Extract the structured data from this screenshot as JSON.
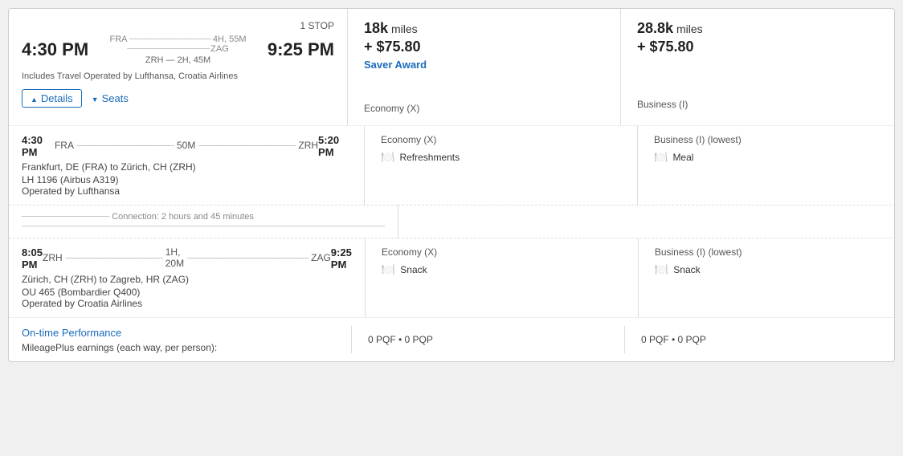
{
  "card": {
    "stop_label": "1 STOP",
    "depart_time": "4:30 PM",
    "arrive_time": "9:25 PM",
    "origin": "FRA",
    "destination": "ZAG",
    "total_duration": "4H, 55M",
    "layover_airport": "ZRH",
    "layover_duration": "2H, 45M",
    "operated_by": "Includes Travel Operated by Lufthansa, Croatia Airlines",
    "details_label": "Details",
    "seats_label": "Seats"
  },
  "economy": {
    "miles": "18k",
    "miles_label": "miles",
    "cash": "+ $75.80",
    "award_label": "Saver Award",
    "cabin": "Economy (X)"
  },
  "business": {
    "miles": "28.8k",
    "miles_label": "miles",
    "cash": "+ $75.80",
    "cabin": "Business (I)"
  },
  "segment1": {
    "depart_time": "4:30 PM",
    "arrive_time": "5:20 PM",
    "origin": "FRA",
    "destination": "ZRH",
    "duration": "50M",
    "route_label": "Frankfurt, DE (FRA) to Zürich, CH (ZRH)",
    "flight_number": "LH 1196 (Airbus A319)",
    "operated_by": "Operated by Lufthansa",
    "economy_cabin": "Economy (X)",
    "business_cabin": "Business (I) (lowest)",
    "economy_meal": "Refreshments",
    "business_meal": "Meal",
    "meal_icon": "🍽"
  },
  "connection": {
    "label": "Connection: 2 hours and 45 minutes"
  },
  "segment2": {
    "depart_time": "8:05 PM",
    "arrive_time": "9:25 PM",
    "origin": "ZRH",
    "destination": "ZAG",
    "duration": "1H, 20M",
    "route_label": "Zürich, CH (ZRH) to Zagreb, HR (ZAG)",
    "flight_number": "OU 465 (Bombardier Q400)",
    "operated_by": "Operated by Croatia Airlines",
    "economy_cabin": "Economy (X)",
    "business_cabin": "Business (I) (lowest)",
    "economy_meal": "Snack",
    "business_meal": "Snack",
    "meal_icon": "🍽"
  },
  "footer": {
    "on_time_link": "On-time Performance",
    "earnings_label": "MileagePlus earnings (each way, per person):",
    "economy_earnings": "0 PQF • 0 PQP",
    "business_earnings": "0 PQF • 0 PQP"
  }
}
